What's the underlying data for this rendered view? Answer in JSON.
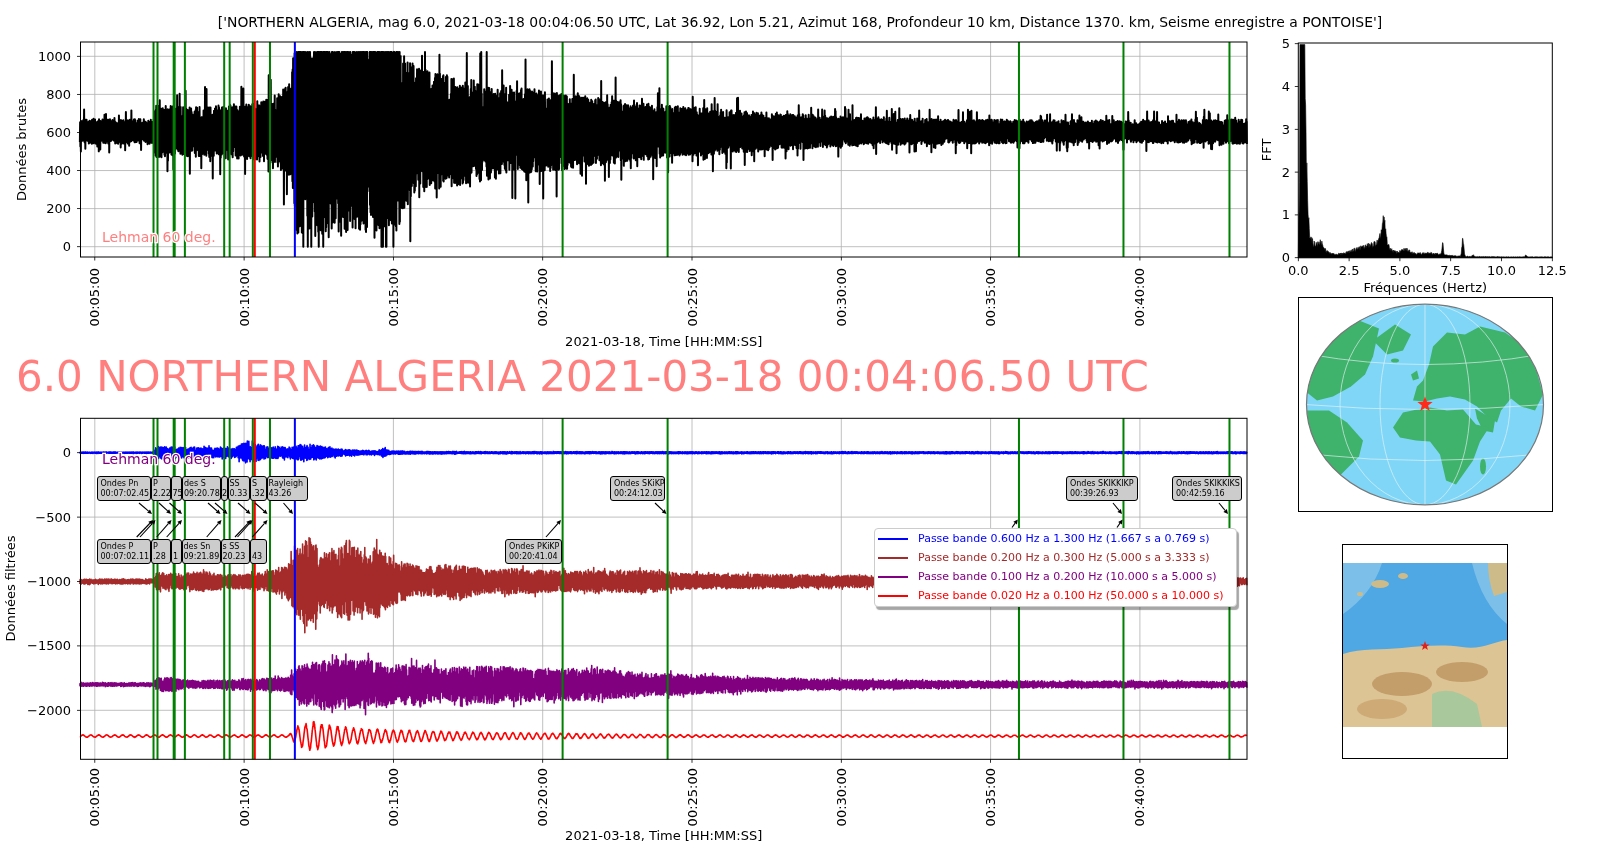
{
  "figure_title": "['NORTHERN ALGERIA, mag 6.0, 2021-03-18 00:04:06.50 UTC, Lat 36.92, Lon 5.21, Azimut 168, Profondeur 10 km, Distance 1370. km, Seisme enregistre a PONTOISE']",
  "raw_plot": {
    "ylabel": "Données brutes",
    "yticks": [
      "1000",
      "800",
      "600",
      "400",
      "200",
      "0"
    ],
    "note": "Lehman 60 deg.",
    "xticks": [
      "00:05:00",
      "00:10:00",
      "00:15:00",
      "00:20:00",
      "00:25:00",
      "00:30:00",
      "00:35:00",
      "00:40:00"
    ],
    "xlabel": "2021-03-18, Time [HH:MM:SS]"
  },
  "spectrum_plot": {
    "ylabel": "FFT",
    "yticks": [
      "5",
      "4",
      "3",
      "2",
      "1",
      "0"
    ],
    "xticks": [
      "0.0",
      "2.5",
      "5.0",
      "7.5",
      "10.0",
      "12.5"
    ],
    "xlabel": "Fréquences (Hertz)"
  },
  "headline": "6.0 NORTHERN ALGERIA 2021-03-18 00:04:06.50 UTC",
  "filtered_plot": {
    "ylabel": "Données filtrées",
    "yticks": [
      "0",
      "−500",
      "−1000",
      "−1500",
      "−2000"
    ],
    "note": "Lehman 60 deg.",
    "annotations_upper": [
      {
        "name": "Ondes Pn",
        "time": "00:07:02.45"
      },
      {
        "name": "P",
        "time": "2.22"
      },
      {
        "time": "75"
      },
      {
        "name": "des S",
        "time": "09:20.78"
      },
      {
        "time": "2"
      },
      {
        "name": "SS",
        "time": "0.33"
      },
      {
        "name": "S",
        "time": ".32"
      },
      {
        "name": "Rayleigh",
        "time": "43.26"
      },
      {
        "name": "Ondes SKiKP",
        "time": "00:24:12.03"
      },
      {
        "name": "Ondes SKIKKIKP",
        "time": "00:39:26.93"
      },
      {
        "name": "Ondes SKIKKIKS",
        "time": "00:42:59.16"
      }
    ],
    "annotations_lower": [
      {
        "name": "Ondes P",
        "time": "00:07:02.11"
      },
      {
        "name": "P",
        "time": ".28"
      },
      {
        "time": "1"
      },
      {
        "name": "des Sn",
        "time": "09:21.89"
      },
      {
        "name": "s SS",
        "time": "20.23"
      },
      {
        "time": "43"
      },
      {
        "name": "Ondes PKiKP",
        "time": "00:20:41.04"
      }
    ],
    "legend": [
      {
        "label": "Passe bande 0.600 Hz a 1.300 Hz (1.667 s a 0.769 s)",
        "color": "#0000ff"
      },
      {
        "label": "Passe bande 0.200 Hz a 0.300 Hz (5.000 s a 3.333 s)",
        "color": "#a52a2a"
      },
      {
        "label": "Passe bande 0.100 Hz a 0.200 Hz (10.000 s a 5.000 s)",
        "color": "#800080"
      },
      {
        "label": "Passe bande 0.020 Hz a 0.100 Hz (50.000 s a 10.000 s)",
        "color": "#ff0000"
      }
    ],
    "xticks": [
      "00:05:00",
      "00:10:00",
      "00:15:00",
      "00:20:00",
      "00:25:00",
      "00:30:00",
      "00:35:00",
      "00:40:00"
    ],
    "xlabel": "2021-03-18, Time [HH:MM:SS]"
  }
}
